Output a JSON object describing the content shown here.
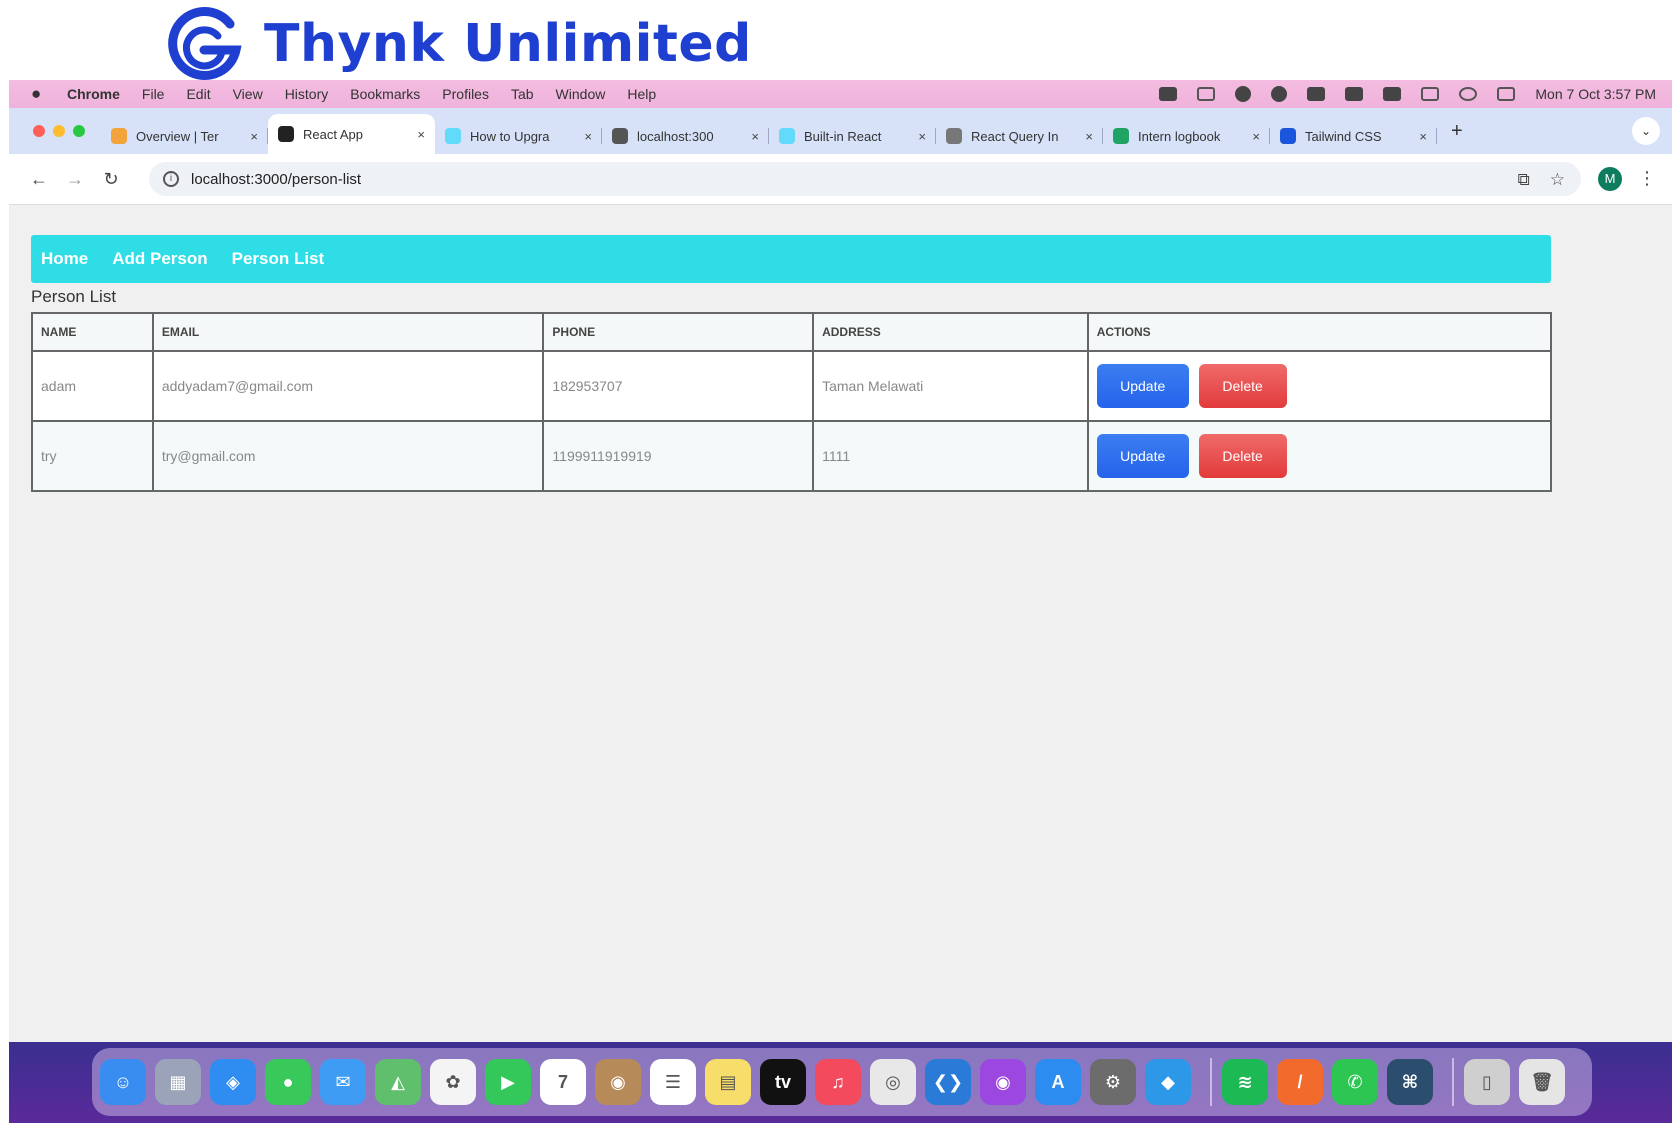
{
  "brand": {
    "name": "Thynk Unlimited",
    "color": "#1e3fd0"
  },
  "menubar": {
    "app": "Chrome",
    "items": [
      "File",
      "Edit",
      "View",
      "History",
      "Bookmarks",
      "Profiles",
      "Tab",
      "Window",
      "Help"
    ],
    "clock": "Mon 7 Oct  3:57 PM"
  },
  "tabs": [
    {
      "title": "Overview | Ter",
      "favicon_color": "#f3a33b",
      "active": false
    },
    {
      "title": "React App",
      "favicon_color": "#222222",
      "active": true
    },
    {
      "title": "How to Upgra",
      "favicon_color": "#61dafb",
      "active": false
    },
    {
      "title": "localhost:300",
      "favicon_color": "#555555",
      "active": false
    },
    {
      "title": "Built-in React",
      "favicon_color": "#61dafb",
      "active": false
    },
    {
      "title": "React Query In",
      "favicon_color": "#777777",
      "active": false
    },
    {
      "title": "Intern logbook",
      "favicon_color": "#1fa463",
      "active": false
    },
    {
      "title": "Tailwind CSS",
      "favicon_color": "#1a56db",
      "active": false
    }
  ],
  "toolbar": {
    "url": "localhost:3000/person-list",
    "avatar_letter": "M"
  },
  "navbar": {
    "links": [
      "Home",
      "Add Person",
      "Person List"
    ],
    "color": "#2fdde6"
  },
  "page": {
    "title": "Person List"
  },
  "table": {
    "headers": [
      "NAME",
      "EMAIL",
      "PHONE",
      "ADDRESS",
      "ACTIONS"
    ],
    "rows": [
      {
        "name": "adam",
        "email": "addyadam7@gmail.com",
        "phone": "182953707",
        "address": "Taman Melawati"
      },
      {
        "name": "try",
        "email": "try@gmail.com",
        "phone": "1199911919919",
        "address": "1111"
      }
    ],
    "update_label": "Update",
    "delete_label": "Delete"
  },
  "dock": {
    "apps": [
      {
        "name": "finder",
        "color": "#3a8df0",
        "glyph": "☺"
      },
      {
        "name": "launchpad",
        "color": "#9aa3b8",
        "glyph": "▦"
      },
      {
        "name": "safari",
        "color": "#2f8cf0",
        "glyph": "◈"
      },
      {
        "name": "messages",
        "color": "#38c95a",
        "glyph": "●"
      },
      {
        "name": "mail",
        "color": "#3f9cf5",
        "glyph": "✉"
      },
      {
        "name": "maps",
        "color": "#5fbf6c",
        "glyph": "◭"
      },
      {
        "name": "photos",
        "color": "#f4f4f4",
        "glyph": "✿"
      },
      {
        "name": "facetime",
        "color": "#34c759",
        "glyph": "▶"
      },
      {
        "name": "calendar",
        "color": "#ffffff",
        "glyph": "7"
      },
      {
        "name": "contacts",
        "color": "#b78a5a",
        "glyph": "◉"
      },
      {
        "name": "reminders",
        "color": "#ffffff",
        "glyph": "☰"
      },
      {
        "name": "notes",
        "color": "#f7dd6a",
        "glyph": "▤"
      },
      {
        "name": "apple-tv",
        "color": "#111111",
        "glyph": "tv"
      },
      {
        "name": "music",
        "color": "#f34a5e",
        "glyph": "♫"
      },
      {
        "name": "chrome",
        "color": "#e8e8e8",
        "glyph": "◎"
      },
      {
        "name": "vscode",
        "color": "#2a7bd8",
        "glyph": "❮❯"
      },
      {
        "name": "podcasts",
        "color": "#9b47e0",
        "glyph": "◉"
      },
      {
        "name": "app-store",
        "color": "#2d8cf0",
        "glyph": "A"
      },
      {
        "name": "system-settings",
        "color": "#6c6c6c",
        "glyph": "⚙"
      },
      {
        "name": "docker",
        "color": "#2e98e8",
        "glyph": "◆"
      }
    ],
    "apps_right": [
      {
        "name": "spotify",
        "color": "#1db954",
        "glyph": "≋"
      },
      {
        "name": "sublime-pencil",
        "color": "#f26b2c",
        "glyph": "/"
      },
      {
        "name": "whatsapp",
        "color": "#2dc653",
        "glyph": "✆"
      },
      {
        "name": "mysql-workbench",
        "color": "#2b4d6e",
        "glyph": "⌘"
      }
    ],
    "apps_end": [
      {
        "name": "iphone-mirroring",
        "color": "#cfcfcf",
        "glyph": "▯"
      },
      {
        "name": "trash",
        "color": "#e5e5e5",
        "glyph": "🗑"
      }
    ]
  }
}
